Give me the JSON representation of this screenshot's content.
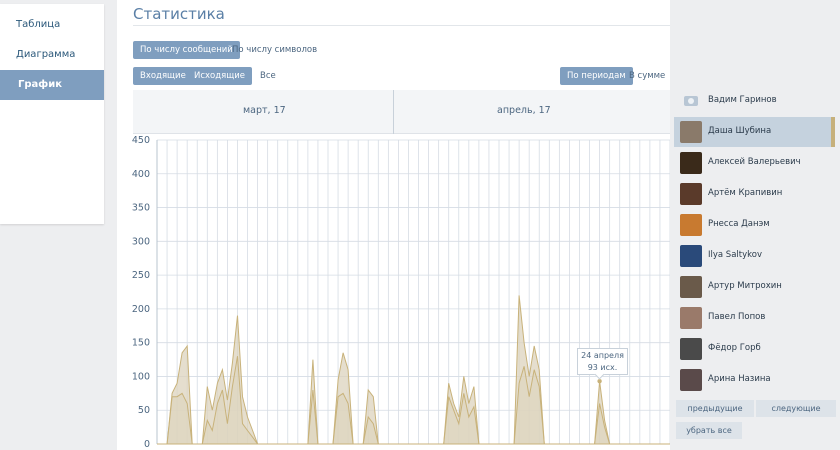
{
  "nav": {
    "items": [
      {
        "label": "Таблица"
      },
      {
        "label": "Диаграмма"
      },
      {
        "label": "График"
      }
    ]
  },
  "header": {
    "title": "Статистика"
  },
  "metric_tabs": {
    "by_messages": "По числу сообщений",
    "by_chars": "По числу символов"
  },
  "direction_tabs": {
    "incoming": "Входящие",
    "outgoing": "Исходящие",
    "all": "Все"
  },
  "period_tabs": {
    "by_periods": "По периодам",
    "total": "В сумме"
  },
  "months": {
    "left": "март, 17",
    "right": "апрель, 17"
  },
  "tooltip": {
    "date": "24 апреля",
    "value": "93 исх."
  },
  "friends": [
    {
      "name": "Вадим Гаринов",
      "avatar": "camera"
    },
    {
      "name": "Даша Шубина",
      "avatar": "#8a7a6a"
    },
    {
      "name": "Алексей Валерьевич",
      "avatar": "#3a2a1a"
    },
    {
      "name": "Артём Крапивин",
      "avatar": "#5a3a2a"
    },
    {
      "name": "Рнесса Данэм",
      "avatar": "#c87a30"
    },
    {
      "name": "Ilya Saltykov",
      "avatar": "#2a4a7a"
    },
    {
      "name": "Артур Митрохин",
      "avatar": "#6a5a4a"
    },
    {
      "name": "Павел Попов",
      "avatar": "#9a7a6a"
    },
    {
      "name": "Фёдор Горб",
      "avatar": "#4a4a4a"
    },
    {
      "name": "Арина Назина",
      "avatar": "#5a4a4a"
    }
  ],
  "pager": {
    "prev": "предыдущие",
    "next": "следующие",
    "clear": "убрать все"
  },
  "colors": {
    "accent": "#7f9ebf",
    "series_fill": "#dcd3bd",
    "series_line": "#c8b27a",
    "grid": "#d5dce4"
  },
  "chart_data": {
    "type": "area",
    "ylim": [
      0,
      450
    ],
    "yticks": [
      0,
      50,
      100,
      150,
      200,
      250,
      300,
      350,
      400,
      450
    ],
    "series": [
      {
        "values": [
          0,
          0,
          0,
          75,
          90,
          135,
          145,
          0,
          0,
          0,
          85,
          50,
          90,
          110,
          65,
          120,
          190,
          70,
          40,
          20,
          0,
          0,
          0,
          0,
          0,
          0,
          0,
          0,
          0,
          0,
          0,
          125,
          0,
          0,
          0,
          0,
          95,
          135,
          110,
          0,
          0,
          0,
          80,
          70,
          0,
          0,
          0,
          0,
          0,
          0,
          0,
          0,
          0,
          0,
          0,
          0,
          0,
          0,
          90,
          60,
          40,
          100,
          60,
          85,
          0,
          0,
          0,
          0,
          0,
          0,
          0,
          0,
          220,
          150,
          100,
          145,
          110,
          0,
          0,
          0,
          0,
          0,
          0,
          0,
          0,
          0,
          0,
          0,
          93,
          35,
          0,
          0,
          0,
          0,
          0,
          0,
          0,
          0,
          0,
          0,
          0,
          0,
          0
        ]
      },
      {
        "values": [
          0,
          0,
          0,
          70,
          70,
          75,
          60,
          0,
          0,
          0,
          35,
          20,
          60,
          80,
          30,
          85,
          130,
          30,
          20,
          10,
          0,
          0,
          0,
          0,
          0,
          0,
          0,
          0,
          0,
          0,
          0,
          80,
          0,
          0,
          0,
          0,
          70,
          75,
          60,
          0,
          0,
          0,
          40,
          30,
          0,
          0,
          0,
          0,
          0,
          0,
          0,
          0,
          0,
          0,
          0,
          0,
          0,
          0,
          70,
          50,
          30,
          75,
          40,
          55,
          0,
          0,
          0,
          0,
          0,
          0,
          0,
          0,
          90,
          115,
          70,
          110,
          85,
          0,
          0,
          0,
          0,
          0,
          0,
          0,
          0,
          0,
          0,
          0,
          60,
          25,
          0,
          0,
          0,
          0,
          0,
          0,
          0,
          0,
          0,
          0,
          0,
          0,
          0
        ]
      }
    ]
  }
}
